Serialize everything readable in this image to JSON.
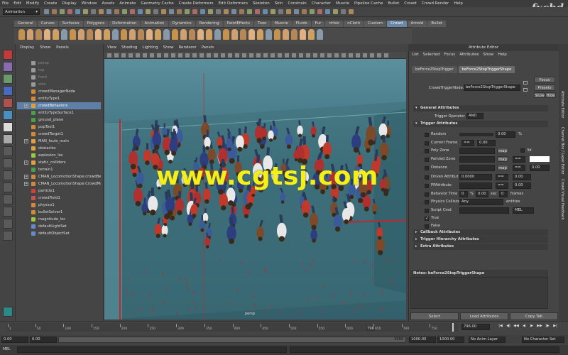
{
  "menubar": [
    "File",
    "Edit",
    "Modify",
    "Create",
    "Display",
    "Window",
    "Assets",
    "Animate",
    "Geometry Cache",
    "Create Deformers",
    "Edit Deformers",
    "Skeleton",
    "Skin",
    "Constrain",
    "Character",
    "Muscle",
    "Pipeline Cache",
    "Bullet",
    "Crowd",
    "Crowd Render",
    "Help"
  ],
  "logo": "fxcbd",
  "mode": "Animation",
  "shelf_tabs": [
    "General",
    "Curves",
    "Surfaces",
    "Polygons",
    "Deformation",
    "Animation",
    "Dynamics",
    "Rendering",
    "PaintEffects",
    "Toon",
    "Muscle",
    "Fluids",
    "Fur",
    "nHair",
    "nCloth",
    "Custom",
    "Crowd",
    "Arnold",
    "Bullet"
  ],
  "shelf_active": "Crowd",
  "outliner": {
    "menu": [
      "Display",
      "Show",
      "Panels"
    ],
    "items": [
      {
        "label": "persp",
        "icon": "camera-icon",
        "dim": true
      },
      {
        "label": "top",
        "icon": "camera-icon",
        "dim": true
      },
      {
        "label": "front",
        "icon": "camera-icon",
        "dim": true
      },
      {
        "label": "side",
        "icon": "camera-icon",
        "dim": true
      },
      {
        "label": "crowdManagerNode",
        "icon": "node-icon"
      },
      {
        "label": "entityType1",
        "icon": "node-icon"
      },
      {
        "label": "crowdBehaviors",
        "icon": "group-icon",
        "expand": true,
        "selected": true
      },
      {
        "label": "entityTypeSurface1",
        "icon": "surface-icon"
      },
      {
        "label": "ground_plane",
        "icon": "surface-icon"
      },
      {
        "label": "popTool1",
        "icon": "node-icon"
      },
      {
        "label": "crowdTarget1",
        "icon": "node-icon"
      },
      {
        "label": "MAN_foule_main",
        "icon": "group-icon",
        "expand": true
      },
      {
        "label": "obstacles",
        "icon": "group-icon"
      },
      {
        "label": "explosion_loc",
        "icon": "locator-icon"
      },
      {
        "label": "static_colliders",
        "icon": "group-icon",
        "expand": true
      },
      {
        "label": "terrain1",
        "icon": "surface-icon"
      },
      {
        "label": "CMAN_LocomotionShape:crowdBe",
        "icon": "node-icon",
        "expand": true
      },
      {
        "label": "CMAN_LocomotionShape:CrowdMa",
        "icon": "node-icon",
        "expand": true
      },
      {
        "label": "particle1",
        "icon": "particle-icon"
      },
      {
        "label": "crowdField1",
        "icon": "field-icon"
      },
      {
        "label": "physics1",
        "icon": "node-icon"
      },
      {
        "label": "bulletSolver1",
        "icon": "node-icon"
      },
      {
        "label": "magnitude_loc",
        "icon": "locator-icon"
      },
      {
        "label": "defaultLightSet",
        "icon": "set-icon"
      },
      {
        "label": "defaultObjectSet",
        "icon": "set-icon"
      }
    ]
  },
  "viewport": {
    "menu": [
      "View",
      "Shading",
      "Lighting",
      "Show",
      "Renderer",
      "Panels"
    ],
    "watermark": "www.cgtsj.com",
    "camera_label": "persp"
  },
  "attribute_editor": {
    "title": "Attribute Editor",
    "menu": [
      "List",
      "Selected",
      "Focus",
      "Attributes",
      "Show",
      "Help"
    ],
    "tabs": [
      "beForce2StopTrigger",
      "beForce2StopTriggerShape"
    ],
    "active_tab": "beForce2StopTriggerShape",
    "node_label": "CrowdTriggerNode:",
    "node_value": "beForce2StopTriggerShape",
    "focus_btn": "Focus",
    "presets_btn": "Presets",
    "show_btn": "Show",
    "hide_btn": "Hide",
    "general_section": "General Attributes",
    "trigger_operator_label": "Trigger Operator",
    "trigger_operator_value": "AND",
    "trigger_section": "Trigger Attributes",
    "rows": {
      "random": {
        "label": "Random",
        "value": "0.00",
        "unit": "%"
      },
      "current_frame": {
        "label": "Current Frame",
        "op": "==",
        "value": "0.00"
      },
      "poly_zone": {
        "label": "Poly Zone",
        "btn": "map",
        "extra": "3d"
      },
      "painted_zone": {
        "label": "Painted Zone",
        "btn": "map",
        "op": "=="
      },
      "distance": {
        "label": "Distance",
        "btn": "map",
        "op": "==",
        "value": "0.00"
      },
      "driven_attribut": {
        "label": "Driven Attribut",
        "value": "0.0000",
        "op": "==",
        "value2": "0.00"
      },
      "ppattribute": {
        "label": "PPAttribute",
        "op": "==",
        "value": "0.00"
      },
      "behavior_time": {
        "label": "Behavior Time",
        "value": "0",
        "pct": "%",
        "secs": "0.00",
        "sec": "sec",
        "frames_val": "0",
        "frames": "frames"
      },
      "physics_collision": {
        "label": "Physics Collision",
        "select": "Any",
        "unit": "entities"
      },
      "script_cmd": {
        "label": "Script Cmd",
        "lang": "MEL"
      },
      "true_label": "True",
      "false_label": "False"
    },
    "collapsed_sections": [
      "Callback Attributes",
      "Trigger Hierarchy Attributes",
      "Extra Attributes"
    ],
    "notes_label": "Notes: beForce2StopTriggerShape",
    "buttons": [
      "Select",
      "Load Attributes",
      "Copy Tab"
    ],
    "side_tabs": [
      "Attribute Editor",
      "Channel Box / Layer Editor",
      "Crowd Visual Feedback"
    ]
  },
  "time_slider": {
    "ticks": [
      "1",
      "50",
      "100",
      "150",
      "200",
      "250",
      "300",
      "350",
      "400",
      "450",
      "500",
      "550",
      "600",
      "650",
      "700",
      "750",
      "796"
    ],
    "current_frame": "796",
    "current_field": "796.00"
  },
  "range_slider": {
    "start": "0.00",
    "start2": "0.00",
    "end": "1000",
    "end_field": "1000.00",
    "end_field2": "1000.00",
    "anim_layer": "No Anim Layer",
    "char_set": "No Character Set"
  },
  "command_line": {
    "lang": "MEL"
  },
  "colors": {
    "accent": "#5d7fa8",
    "watermark": "#f3ef17",
    "viewport_bg": "#4a7f8c",
    "red_line": "#c0282e"
  }
}
